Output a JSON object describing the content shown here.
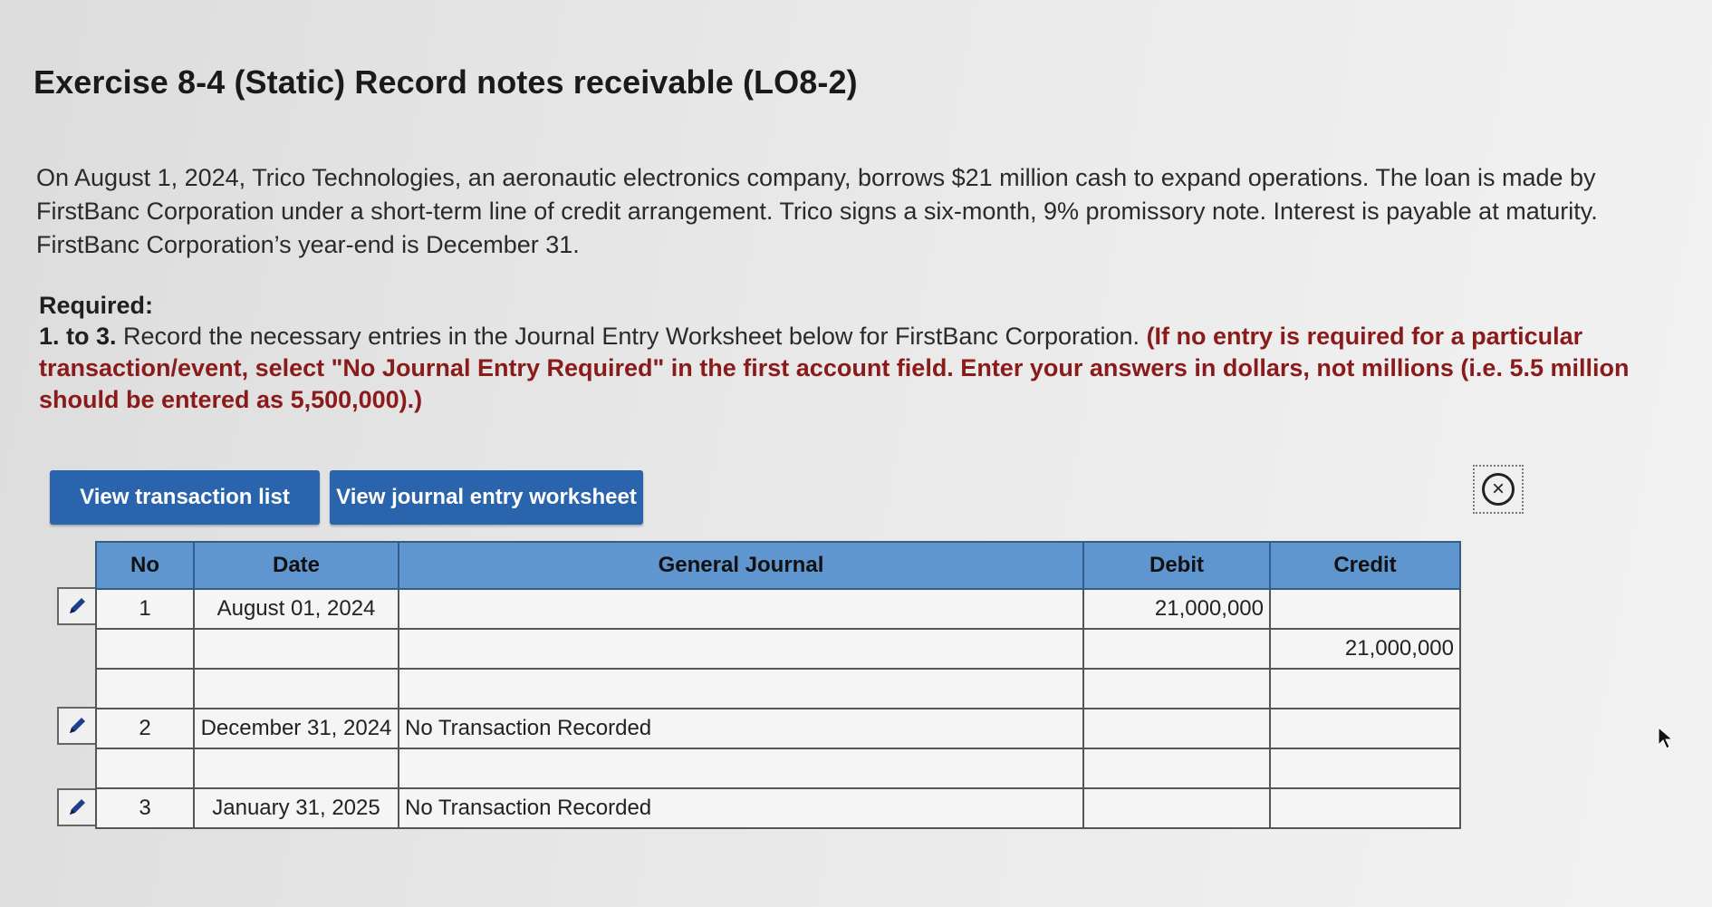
{
  "exercise": {
    "title": "Exercise 8-4 (Static) Record notes receivable (LO8-2)",
    "intro": "On August 1, 2024, Trico Technologies, an aeronautic electronics company, borrows $21 million cash to expand operations. The loan is made by FirstBanc Corporation under a short-term line of credit arrangement. Trico signs a six-month, 9% promissory note. Interest is payable at maturity. FirstBanc Corporation’s year-end is December 31.",
    "required_heading": "Required:",
    "instruction_number": "1. to 3.",
    "instruction_text": " Record the necessary entries in the Journal Entry Worksheet below for FirstBanc Corporation. ",
    "instruction_warning": "(If no entry is required for a particular transaction/event, select \"No Journal Entry Required\" in the first account field. Enter your answers in dollars, not millions (i.e. 5.5 million should be entered as 5,500,000).)"
  },
  "toolbar": {
    "view_transactions_label": "View transaction list",
    "view_worksheet_label": "View journal entry worksheet",
    "close_icon": "close-circle-icon"
  },
  "journal": {
    "columns": [
      "No",
      "Date",
      "General Journal",
      "Debit",
      "Credit"
    ],
    "rows": [
      {
        "no": "1",
        "date": "August 01, 2024",
        "account": "",
        "debit": "21,000,000",
        "credit": ""
      },
      {
        "no": "",
        "date": "",
        "account": "",
        "debit": "",
        "credit": "21,000,000"
      },
      {
        "no": "",
        "date": "",
        "account": "",
        "debit": "",
        "credit": ""
      },
      {
        "no": "2",
        "date": "December 31, 2024",
        "account": "No Transaction Recorded",
        "debit": "",
        "credit": ""
      },
      {
        "no": "",
        "date": "",
        "account": "",
        "debit": "",
        "credit": ""
      },
      {
        "no": "3",
        "date": "January 31, 2025",
        "account": "No Transaction Recorded",
        "debit": "",
        "credit": ""
      }
    ]
  },
  "colors": {
    "button": "#2a64ad",
    "header": "#5f96cf",
    "warning": "#8b1a1a"
  }
}
